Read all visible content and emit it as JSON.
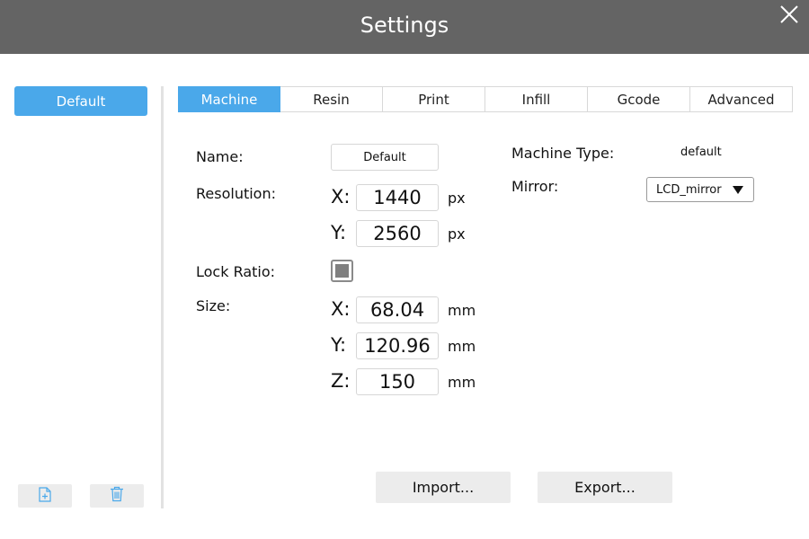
{
  "window": {
    "title": "Settings"
  },
  "sidebar": {
    "items": [
      {
        "label": "Default",
        "selected": true
      }
    ],
    "add_icon": "file-add-icon",
    "delete_icon": "trash-icon"
  },
  "tabs": [
    {
      "label": "Machine",
      "active": true
    },
    {
      "label": "Resin",
      "active": false
    },
    {
      "label": "Print",
      "active": false
    },
    {
      "label": "Infill",
      "active": false
    },
    {
      "label": "Gcode",
      "active": false
    },
    {
      "label": "Advanced",
      "active": false
    }
  ],
  "machine": {
    "name_label": "Name:",
    "name_value": "Default",
    "resolution_label": "Resolution:",
    "resolution": {
      "x_label": "X:",
      "x_value": "1440",
      "x_unit": "px",
      "y_label": "Y:",
      "y_value": "2560",
      "y_unit": "px"
    },
    "lock_ratio_label": "Lock Ratio:",
    "lock_ratio_checked": true,
    "size_label": "Size:",
    "size": {
      "x_label": "X:",
      "x_value": "68.04",
      "x_unit": "mm",
      "y_label": "Y:",
      "y_value": "120.96",
      "y_unit": "mm",
      "z_label": "Z:",
      "z_value": "150",
      "z_unit": "mm"
    },
    "machine_type_label": "Machine Type:",
    "machine_type_value": "default",
    "mirror_label": "Mirror:",
    "mirror_value": "LCD_mirror"
  },
  "actions": {
    "import_label": "Import...",
    "export_label": "Export..."
  },
  "colors": {
    "titlebar": "#646464",
    "accent": "#4aa8ea",
    "button_bg": "#ececec"
  }
}
